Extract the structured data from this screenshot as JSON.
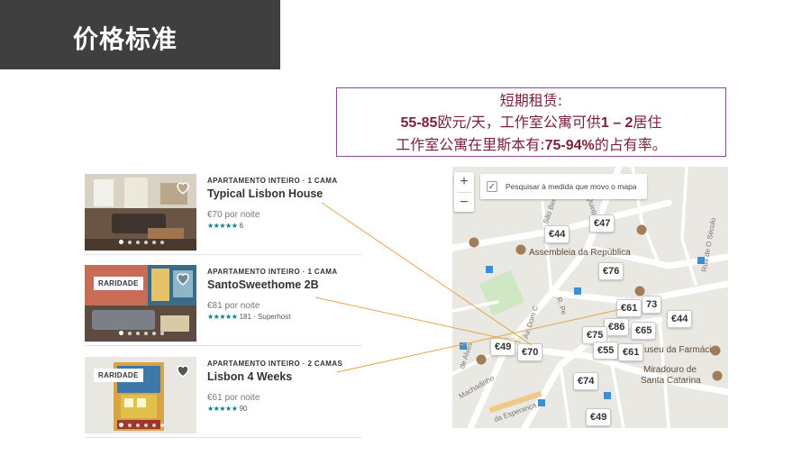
{
  "slide": {
    "title": "价格标准"
  },
  "callout": {
    "line1": "短期租赁:",
    "line2_a": "55-85",
    "line2_b": "欧元/天，工作室公寓可供",
    "line2_c": "1 – 2",
    "line2_d": "居住",
    "line3_a": "工作室公寓在里斯本有:",
    "line3_b": "75-94%",
    "line3_c": "的占有率。"
  },
  "listings": [
    {
      "type": "APARTAMENTO INTEIRO · 1 CAMA",
      "name": "Typical Lisbon House",
      "price": "€70 por noite",
      "stars": "★★★★★",
      "reviews": "6",
      "badge": ""
    },
    {
      "type": "APARTAMENTO INTEIRO · 1 CAMA",
      "name": "SantoSweethome 2B",
      "price": "€81 por noite",
      "stars": "★★★★★",
      "reviews": "181 · Superhost",
      "badge": "RARIDADE"
    },
    {
      "type": "APARTAMENTO INTEIRO · 2 CAMAS",
      "name": "Lisbon 4 Weeks",
      "price": "€61 por noite",
      "stars": "★★★★★",
      "reviews": "90",
      "badge": "RARIDADE"
    }
  ],
  "map": {
    "zoom_in": "+",
    "zoom_out": "−",
    "search_toggle_label": "Pesquisar à medida que movo o mapa",
    "places": {
      "republica": "Assembleia da República",
      "farmacia": "useu da Farmácia",
      "miradouro_1": "Miradouro de",
      "miradouro_2": "Santa Catarina"
    },
    "streets": {
      "sao_bento": "São Ben",
      "quintinha": "R. Quintinha",
      "seculo": "Rua de O Século",
      "av_dom": "Av. Dom C",
      "rua_pe": "R. Pe",
      "alves": "de Alves",
      "machadinho": "Machadinho",
      "esperanca": "da Esperança"
    },
    "pins": {
      "p47": "€47",
      "p44a": "€44",
      "p76": "€76",
      "p73": "73",
      "p61a": "€61",
      "p44b": "€44",
      "p86": "€86",
      "p65": "€65",
      "p75": "€75",
      "p55": "€55",
      "p61b": "€61",
      "p49a": "€49",
      "p70": "€70",
      "p74": "€74",
      "p49b": "€49"
    },
    "colors": {
      "pin_border": "#c8c8c8",
      "road": "#ffffff",
      "park": "#cfe7c3",
      "connector": "#e0a84a"
    }
  }
}
